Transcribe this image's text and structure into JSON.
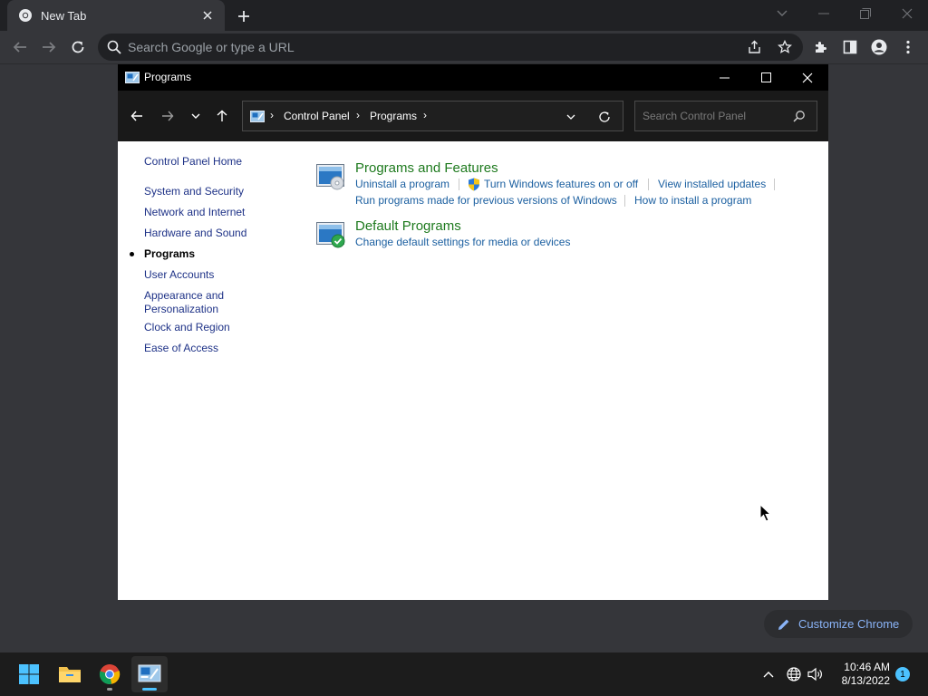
{
  "browser": {
    "tab_title": "New Tab",
    "omnibox_placeholder": "Search Google or type a URL",
    "customize_label": "Customize Chrome"
  },
  "window": {
    "title": "Programs",
    "breadcrumbs": [
      "Control Panel",
      "Programs"
    ],
    "search_placeholder": "Search Control Panel"
  },
  "sidebar": {
    "items": [
      {
        "label": "Control Panel Home"
      },
      {
        "label": "System and Security"
      },
      {
        "label": "Network and Internet"
      },
      {
        "label": "Hardware and Sound"
      },
      {
        "label": "Programs",
        "current": true
      },
      {
        "label": "User Accounts"
      },
      {
        "label": "Appearance and Personalization"
      },
      {
        "label": "Clock and Region"
      },
      {
        "label": "Ease of Access"
      }
    ]
  },
  "categories": [
    {
      "heading": "Programs and Features",
      "links": [
        "Uninstall a program",
        "Turn Windows features on or off",
        "View installed updates",
        "Run programs made for previous versions of Windows",
        "How to install a program"
      ]
    },
    {
      "heading": "Default Programs",
      "links": [
        "Change default settings for media or devices"
      ]
    }
  ],
  "taskbar": {
    "time": "10:46 AM",
    "date": "8/13/2022",
    "notification_count": "1"
  },
  "colors": {
    "category_heading": "#1e7a1e",
    "task_link": "#1b5fa0",
    "nav_link": "#1e3287",
    "taskbar_bg": "#1c1c1c"
  }
}
